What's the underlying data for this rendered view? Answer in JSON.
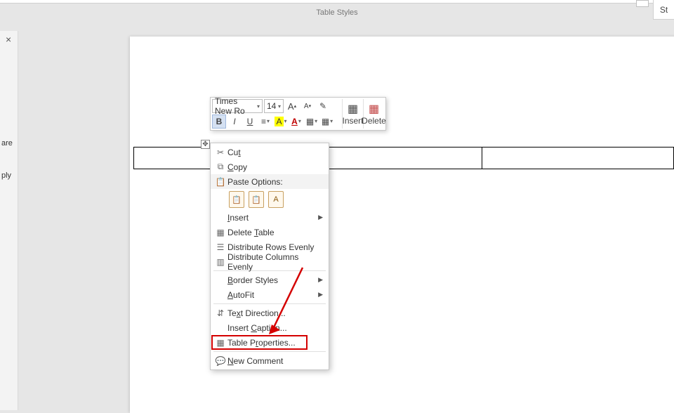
{
  "ribbon": {
    "group_label": "Table Styles",
    "right_label": "St"
  },
  "left_panel": {
    "close": "×",
    "line1": "are",
    "line2": "ply"
  },
  "mini_toolbar": {
    "font": "Times New Ro",
    "size": "14",
    "grow": "A",
    "shrink": "A",
    "painter": "✎",
    "bold": "B",
    "italic": "I",
    "underline": "U",
    "center": "≡",
    "highlight": "A",
    "font_color": "A",
    "border": "▦",
    "shading": "▦",
    "insert_label": "Insert",
    "delete_label": "Delete"
  },
  "table_handle": "✥",
  "ctx": {
    "cut": "Cut",
    "copy": "Copy",
    "paste_header": "Paste Options:",
    "insert": "Insert",
    "delete_table": "Delete Table",
    "dist_rows": "Distribute Rows Evenly",
    "dist_cols": "Distribute Columns Evenly",
    "border_styles": "Border Styles",
    "autofit": "AutoFit",
    "text_direction": "Text Direction...",
    "insert_caption": "Insert Caption...",
    "table_properties": "Table Properties...",
    "new_comment": "New Comment"
  },
  "accelerators": {
    "cut": "t",
    "copy": "C",
    "insert": "I",
    "delete_table": "T",
    "border_styles": "B",
    "autofit": "A",
    "text_direction": "x",
    "insert_caption": "C",
    "table_properties": "R",
    "new_comment": "N"
  }
}
